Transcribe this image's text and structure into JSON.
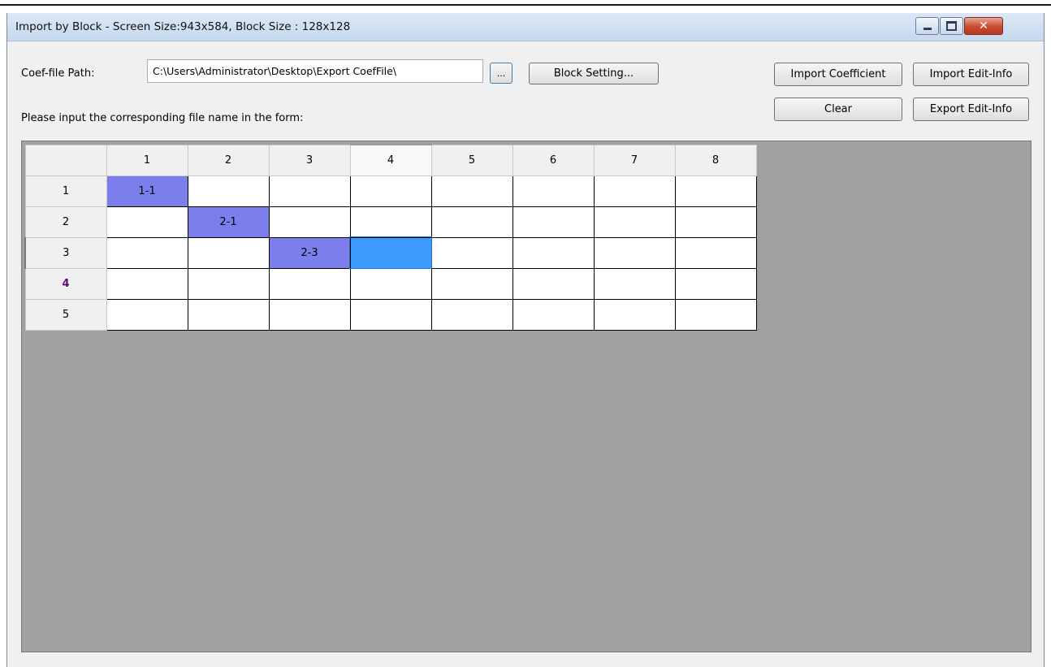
{
  "window": {
    "title": "Import by Block - Screen Size:943x584,  Block Size : 128x128",
    "close_glyph": "✕"
  },
  "path": {
    "label": "Coef-file Path:",
    "value": "C:\\Users\\Administrator\\Desktop\\Export CoefFile\\"
  },
  "buttons": {
    "browse": "...",
    "block_setting": "Block Setting...",
    "import_coefficient": "Import Coefficient",
    "import_edit_info": "Import Edit-Info",
    "clear": "Clear",
    "export_edit_info": "Export Edit-Info"
  },
  "instruction": "Please input the corresponding file name in the form:",
  "grid": {
    "columns": [
      "1",
      "2",
      "3",
      "4",
      "5",
      "6",
      "7",
      "8"
    ],
    "rows": [
      {
        "header": "1",
        "cells": [
          "1-1",
          "",
          "",
          "",
          "",
          "",
          "",
          ""
        ]
      },
      {
        "header": "2",
        "cells": [
          "",
          "2-1",
          "",
          "",
          "",
          "",
          "",
          ""
        ]
      },
      {
        "header": "3",
        "cells": [
          "",
          "",
          "2-3",
          "",
          "",
          "",
          "",
          ""
        ]
      },
      {
        "header": "4",
        "cells": [
          "",
          "",
          "",
          "",
          "",
          "",
          "",
          ""
        ]
      },
      {
        "header": "5",
        "cells": [
          "",
          "",
          "",
          "",
          "",
          "",
          "",
          ""
        ]
      }
    ]
  },
  "colors": {
    "filled_cell": "#7b7eeb",
    "selected_cell": "#3f9aff",
    "grid_background": "#a0a0a0"
  }
}
